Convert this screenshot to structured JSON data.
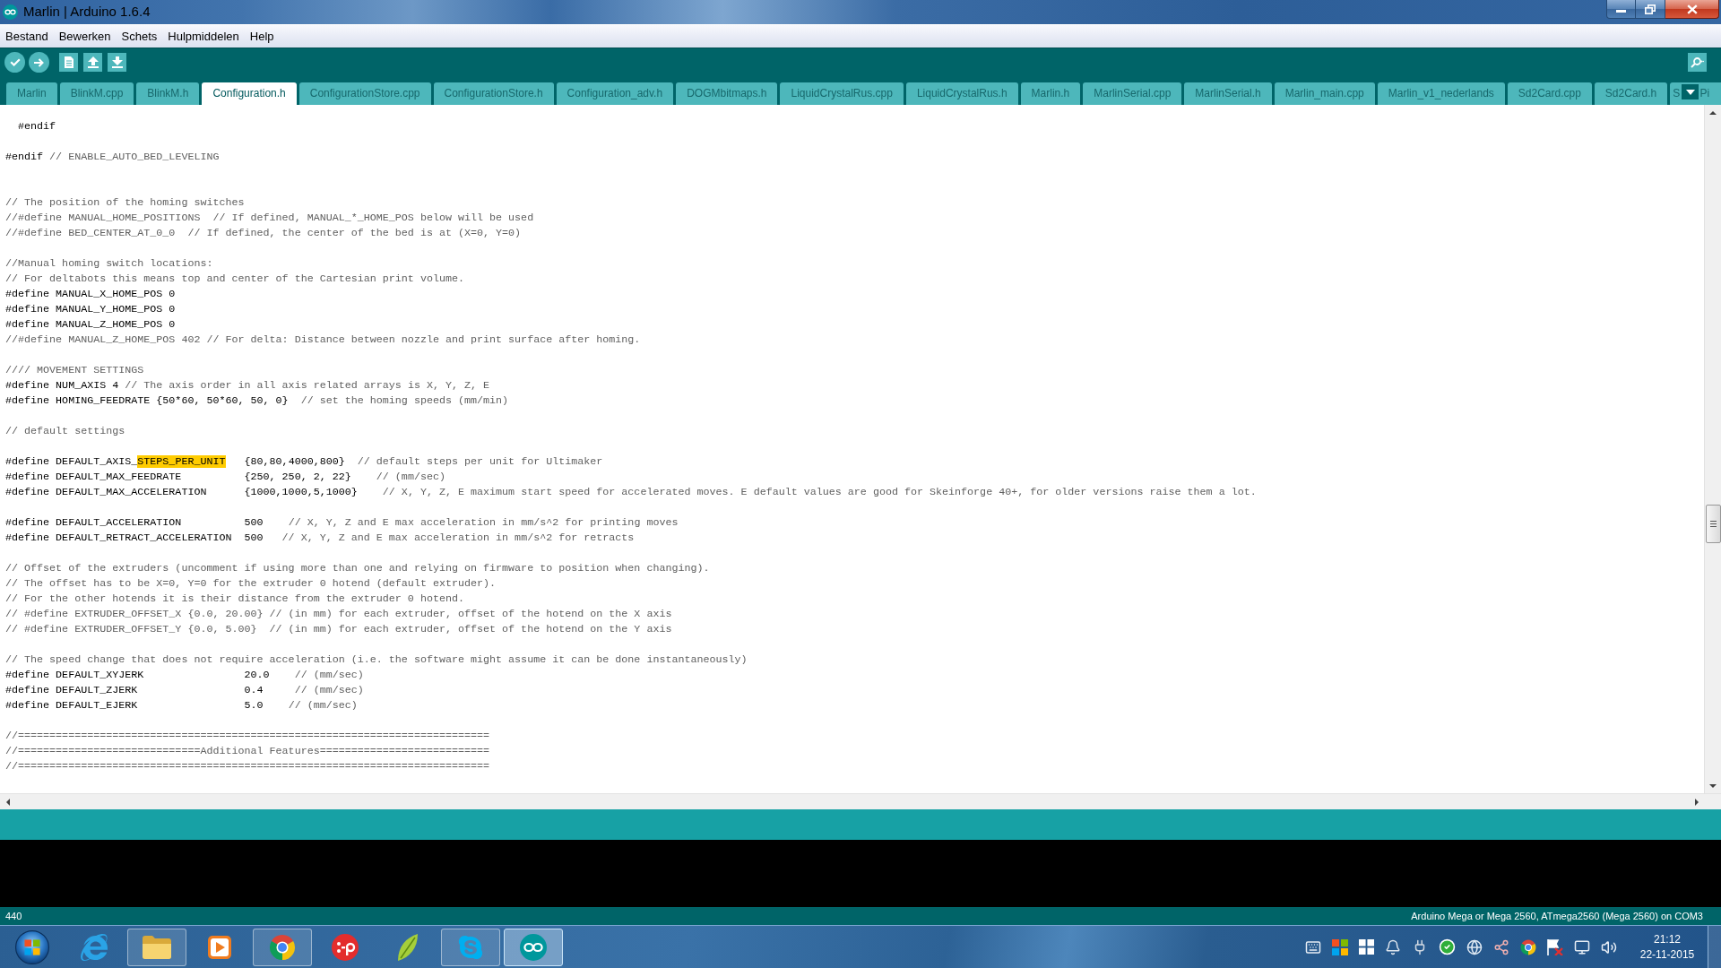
{
  "window": {
    "title": "Marlin | Arduino 1.6.4"
  },
  "menu": [
    "Bestand",
    "Bewerken",
    "Schets",
    "Hulpmiddelen",
    "Help"
  ],
  "tabs": [
    {
      "label": "Marlin",
      "selected": false
    },
    {
      "label": "BlinkM.cpp",
      "selected": false
    },
    {
      "label": "BlinkM.h",
      "selected": false
    },
    {
      "label": "Configuration.h",
      "selected": true
    },
    {
      "label": "ConfigurationStore.cpp",
      "selected": false
    },
    {
      "label": "ConfigurationStore.h",
      "selected": false
    },
    {
      "label": "Configuration_adv.h",
      "selected": false
    },
    {
      "label": "DOGMbitmaps.h",
      "selected": false
    },
    {
      "label": "LiquidCrystalRus.cpp",
      "selected": false
    },
    {
      "label": "LiquidCrystalRus.h",
      "selected": false
    },
    {
      "label": "Marlin.h",
      "selected": false
    },
    {
      "label": "MarlinSerial.cpp",
      "selected": false
    },
    {
      "label": "MarlinSerial.h",
      "selected": false
    },
    {
      "label": "Marlin_main.cpp",
      "selected": false
    },
    {
      "label": "Marlin_v1_nederlands",
      "selected": false
    },
    {
      "label": "Sd2Card.cpp",
      "selected": false
    },
    {
      "label": "Sd2Card.h",
      "selected": false
    },
    {
      "label": "S",
      "label_after_menu": "Pi",
      "selected": false
    }
  ],
  "editor": {
    "lines": [
      {
        "kind": "text",
        "segments": [
          {
            "kind": "code",
            "text": "  #endif"
          }
        ]
      },
      {
        "kind": "blank"
      },
      {
        "kind": "text",
        "segments": [
          {
            "kind": "code",
            "text": "#endif "
          },
          {
            "kind": "comment",
            "text": "// ENABLE_AUTO_BED_LEVELING"
          }
        ]
      },
      {
        "kind": "blank"
      },
      {
        "kind": "blank"
      },
      {
        "kind": "text",
        "segments": [
          {
            "kind": "comment",
            "text": "// The position of the homing switches"
          }
        ]
      },
      {
        "kind": "text",
        "segments": [
          {
            "kind": "comment",
            "text": "//#define MANUAL_HOME_POSITIONS  // If defined, MANUAL_*_HOME_POS below will be used"
          }
        ]
      },
      {
        "kind": "text",
        "segments": [
          {
            "kind": "comment",
            "text": "//#define BED_CENTER_AT_0_0  // If defined, the center of the bed is at (X=0, Y=0)"
          }
        ]
      },
      {
        "kind": "blank"
      },
      {
        "kind": "text",
        "segments": [
          {
            "kind": "comment",
            "text": "//Manual homing switch locations:"
          }
        ]
      },
      {
        "kind": "text",
        "segments": [
          {
            "kind": "comment",
            "text": "// For deltabots this means top and center of the Cartesian print volume."
          }
        ]
      },
      {
        "kind": "text",
        "segments": [
          {
            "kind": "code",
            "text": "#define MANUAL_X_HOME_POS 0"
          }
        ]
      },
      {
        "kind": "text",
        "segments": [
          {
            "kind": "code",
            "text": "#define MANUAL_Y_HOME_POS 0"
          }
        ]
      },
      {
        "kind": "text",
        "segments": [
          {
            "kind": "code",
            "text": "#define MANUAL_Z_HOME_POS 0"
          }
        ]
      },
      {
        "kind": "text",
        "segments": [
          {
            "kind": "comment",
            "text": "//#define MANUAL_Z_HOME_POS 402 // For delta: Distance between nozzle and print surface after homing."
          }
        ]
      },
      {
        "kind": "blank"
      },
      {
        "kind": "text",
        "segments": [
          {
            "kind": "comment",
            "text": "//// MOVEMENT SETTINGS"
          }
        ]
      },
      {
        "kind": "text",
        "segments": [
          {
            "kind": "code",
            "text": "#define NUM_AXIS 4 "
          },
          {
            "kind": "comment",
            "text": "// The axis order in all axis related arrays is X, Y, Z, E"
          }
        ]
      },
      {
        "kind": "text",
        "segments": [
          {
            "kind": "code",
            "text": "#define HOMING_FEEDRATE {50*60, 50*60, 50, 0}  "
          },
          {
            "kind": "comment",
            "text": "// set the homing speeds (mm/min)"
          }
        ]
      },
      {
        "kind": "blank"
      },
      {
        "kind": "text",
        "segments": [
          {
            "kind": "comment",
            "text": "// default settings"
          }
        ]
      },
      {
        "kind": "blank"
      },
      {
        "kind": "text",
        "segments": [
          {
            "kind": "code",
            "text": "#define DEFAULT_AXIS_"
          },
          {
            "kind": "match",
            "text": "STEPS_PER_UNIT"
          },
          {
            "kind": "code",
            "text": "   {80,80,4000,800}  "
          },
          {
            "kind": "comment",
            "text": "// default steps per unit for Ultimaker"
          }
        ]
      },
      {
        "kind": "text",
        "segments": [
          {
            "kind": "code",
            "text": "#define DEFAULT_MAX_FEEDRATE          {250, 250, 2, 22}    "
          },
          {
            "kind": "comment",
            "text": "// (mm/sec)"
          }
        ]
      },
      {
        "kind": "text",
        "segments": [
          {
            "kind": "code",
            "text": "#define DEFAULT_MAX_ACCELERATION      {1000,1000,5,1000}    "
          },
          {
            "kind": "comment",
            "text": "// X, Y, Z, E maximum start speed for accelerated moves. E default values are good for Skeinforge 40+, for older versions raise them a lot."
          }
        ]
      },
      {
        "kind": "blank"
      },
      {
        "kind": "text",
        "segments": [
          {
            "kind": "code",
            "text": "#define DEFAULT_ACCELERATION          500    "
          },
          {
            "kind": "comment",
            "text": "// X, Y, Z and E max acceleration in mm/s^2 for printing moves"
          }
        ]
      },
      {
        "kind": "text",
        "segments": [
          {
            "kind": "code",
            "text": "#define DEFAULT_RETRACT_ACCELERATION  500   "
          },
          {
            "kind": "comment",
            "text": "// X, Y, Z and E max acceleration in mm/s^2 for retracts"
          }
        ]
      },
      {
        "kind": "blank"
      },
      {
        "kind": "text",
        "segments": [
          {
            "kind": "comment",
            "text": "// Offset of the extruders (uncomment if using more than one and relying on firmware to position when changing)."
          }
        ]
      },
      {
        "kind": "text",
        "segments": [
          {
            "kind": "comment",
            "text": "// The offset has to be X=0, Y=0 for the extruder 0 hotend (default extruder)."
          }
        ]
      },
      {
        "kind": "text",
        "segments": [
          {
            "kind": "comment",
            "text": "// For the other hotends it is their distance from the extruder 0 hotend."
          }
        ]
      },
      {
        "kind": "text",
        "segments": [
          {
            "kind": "comment",
            "text": "// #define EXTRUDER_OFFSET_X {0.0, 20.00} // (in mm) for each extruder, offset of the hotend on the X axis"
          }
        ]
      },
      {
        "kind": "text",
        "segments": [
          {
            "kind": "comment",
            "text": "// #define EXTRUDER_OFFSET_Y {0.0, 5.00}  // (in mm) for each extruder, offset of the hotend on the Y axis"
          }
        ]
      },
      {
        "kind": "blank"
      },
      {
        "kind": "text",
        "segments": [
          {
            "kind": "comment",
            "text": "// The speed change that does not require acceleration (i.e. the software might assume it can be done instantaneously)"
          }
        ]
      },
      {
        "kind": "text",
        "segments": [
          {
            "kind": "code",
            "text": "#define DEFAULT_XYJERK                20.0    "
          },
          {
            "kind": "comment",
            "text": "// (mm/sec)"
          }
        ]
      },
      {
        "kind": "text",
        "segments": [
          {
            "kind": "code",
            "text": "#define DEFAULT_ZJERK                 0.4     "
          },
          {
            "kind": "comment",
            "text": "// (mm/sec)"
          }
        ]
      },
      {
        "kind": "text",
        "segments": [
          {
            "kind": "code",
            "text": "#define DEFAULT_EJERK                 5.0    "
          },
          {
            "kind": "comment",
            "text": "// (mm/sec)"
          }
        ]
      },
      {
        "kind": "blank"
      },
      {
        "kind": "text",
        "segments": [
          {
            "kind": "comment",
            "text": "//==========================================================================="
          }
        ]
      },
      {
        "kind": "text",
        "segments": [
          {
            "kind": "comment",
            "text": "//=============================Additional Features==========================="
          }
        ]
      },
      {
        "kind": "text",
        "segments": [
          {
            "kind": "comment",
            "text": "//==========================================================================="
          }
        ]
      }
    ]
  },
  "status_bar": {
    "line_number": "440",
    "board": "Arduino Mega or Mega 2560, ATmega2560 (Mega 2560) on COM3"
  },
  "taskbar": {
    "apps": [
      {
        "running": false,
        "selected": false
      },
      {
        "running": true,
        "selected": false
      },
      {
        "running": false,
        "selected": false
      },
      {
        "running": true,
        "selected": false
      },
      {
        "running": false,
        "selected": false
      },
      {
        "running": false,
        "selected": false
      },
      {
        "running": true,
        "selected": false
      },
      {
        "running": true,
        "selected": true
      }
    ],
    "clock": {
      "time": "21:12",
      "date": "22-11-2015"
    }
  }
}
